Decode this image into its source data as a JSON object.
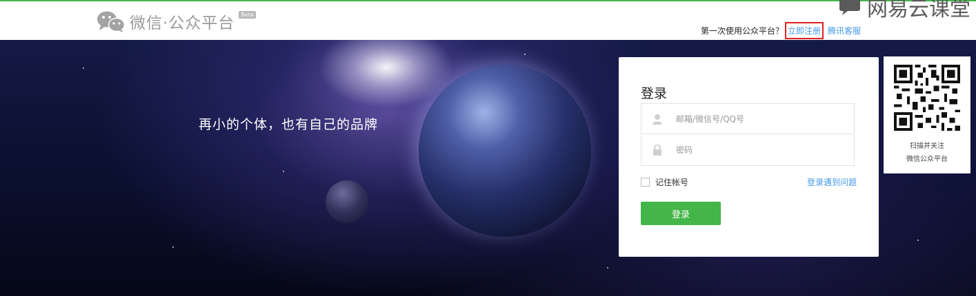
{
  "header": {
    "logo_text": "微信·公众平台",
    "beta": "Beta",
    "first_time_text": "第一次使用公众平台？",
    "register_link": "立即注册",
    "service_link": "腾讯客服",
    "watermark": "网易云课堂"
  },
  "banner": {
    "slogan": "再小的个体，也有自己的品牌"
  },
  "login": {
    "title": "登录",
    "username_placeholder": "邮箱/微信号/QQ号",
    "password_placeholder": "密码",
    "remember_label": "记住帐号",
    "help_link": "登录遇到问题",
    "button_label": "登录"
  },
  "qr": {
    "line1": "扫描并关注",
    "line2": "微信公众平台"
  },
  "colors": {
    "brand_green": "#44b549",
    "link_blue": "#459ae9",
    "highlight_red": "#e02020"
  }
}
